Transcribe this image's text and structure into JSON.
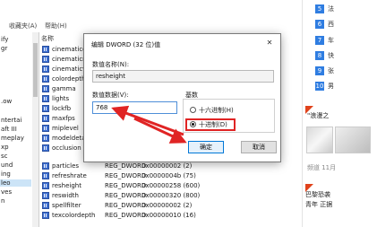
{
  "menubar": {
    "favorites": "收藏夹(A)",
    "help": "帮助(H)"
  },
  "tree": {
    "items": [
      "ify",
      "gr",
      ".ow",
      "ntertai",
      "aft III",
      "meplay",
      "xp",
      "sc",
      "und",
      "ing",
      "leo",
      "ves",
      "n"
    ]
  },
  "list": {
    "header_name": "名称",
    "rows": [
      {
        "name": "cinematicov",
        "type": "",
        "data": ""
      },
      {
        "name": "cinematicret",
        "type": "",
        "data": ""
      },
      {
        "name": "cinematicvic",
        "type": "",
        "data": ""
      },
      {
        "name": "colordepth",
        "type": "",
        "data": ""
      },
      {
        "name": "gamma",
        "type": "",
        "data": ""
      },
      {
        "name": "lights",
        "type": "",
        "data": ""
      },
      {
        "name": "lockfb",
        "type": "",
        "data": ""
      },
      {
        "name": "maxfps",
        "type": "",
        "data": ""
      },
      {
        "name": "miplevel",
        "type": "",
        "data": ""
      },
      {
        "name": "modeldetail",
        "type": "",
        "data": ""
      },
      {
        "name": "occlusion",
        "type": "",
        "data": ""
      },
      {
        "name": "particles",
        "type": "REG_DWORD",
        "data": "0x00000002 (2)"
      },
      {
        "name": "refreshrate",
        "type": "REG_DWORD",
        "data": "0x0000004b (75)"
      },
      {
        "name": "resheight",
        "type": "REG_DWORD",
        "data": "0x00000258 (600)"
      },
      {
        "name": "reswidth",
        "type": "REG_DWORD",
        "data": "0x00000320 (800)"
      },
      {
        "name": "spellfilter",
        "type": "REG_DWORD",
        "data": "0x00000002 (2)"
      },
      {
        "name": "texcolordepth",
        "type": "REG_DWORD",
        "data": "0x00000010 (16)"
      }
    ]
  },
  "dialog": {
    "title": "编辑 DWORD (32 位)值",
    "close": "✕",
    "name_label": "数值名称(N):",
    "name_value": "resheight",
    "data_label": "数值数据(V):",
    "data_value": "768",
    "base_label": "基数",
    "hex_label": "十六进制(H)",
    "dec_label": "十进制(D)",
    "ok_label": "确定",
    "cancel_label": "取消"
  },
  "news": {
    "ranks": [
      {
        "num": "5",
        "text": "法"
      },
      {
        "num": "6",
        "text": "西"
      },
      {
        "num": "7",
        "text": "车"
      },
      {
        "num": "8",
        "text": "快"
      },
      {
        "num": "9",
        "text": "张"
      },
      {
        "num": "10",
        "text": "男"
      }
    ],
    "headline1": "\"浪漫之",
    "meta": "频道 11月",
    "headline2a": "巴黎恐袭",
    "headline2b": "青年 正据"
  },
  "colors": {
    "accent": "#0078d7",
    "annotation": "#e02424",
    "rank_badge": "#2f7de1",
    "hot_flag": "#e0421b"
  }
}
